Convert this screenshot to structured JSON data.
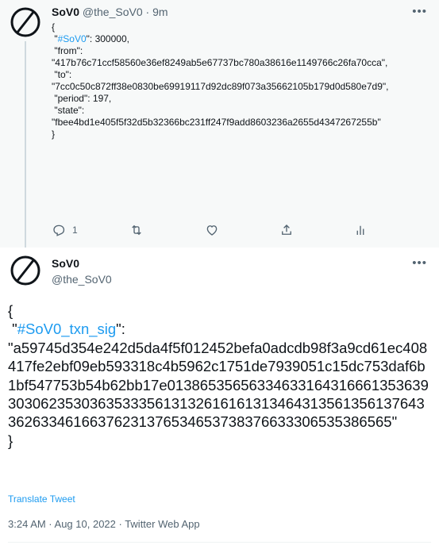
{
  "parent_tweet": {
    "display_name": "SoV0",
    "handle": "@the_SoV0",
    "separator": "·",
    "time": "9m",
    "body": {
      "open": "{",
      "hashtag_quote": " \"",
      "hashtag": "#SoV0",
      "hashtag_rest": "\": 300000,",
      "from_key": " \"from\":",
      "from_value": "\"417b76c71ccf58560e36ef8249ab5e67737bc780a38616e1149766c26fa70cca\",",
      "to_key": " \"to\":",
      "to_value": "\"7cc0c50c872ff38e0830be69919117d92dc89f073a35662105b179d0d580e7d9\",",
      "period": " \"period\": 197,",
      "state_key": " \"state\":",
      "state_value": "\"fbee4bd1e405f5f32d5b32366bc231ff247f9add8603236a2655d4347267255b\"",
      "close": "}"
    },
    "reply_count": "1"
  },
  "main_tweet": {
    "display_name": "SoV0",
    "handle": "@the_SoV0",
    "body": {
      "open": "{",
      "hashtag_quote": " \"",
      "hashtag": "#SoV0_txn_sig",
      "hashtag_rest": "\":",
      "sig_value": "\"a59745d354e242d5da4f5f012452befa0adcdb98f3a9cd61ec408417fe2ebf09eb593318c4b5962c1751de7939051c15dc753daf6b1bf547753b54b62bb17e0138653565633463316431666135363930306235303635333561313261616131346431356135613764336263346166376231376534653738376633306535386565\"",
      "close": "}"
    },
    "translate_label": "Translate Tweet",
    "meta": "3:24 AM · Aug 10, 2022 · Twitter Web App"
  },
  "icons": {
    "avatar": "null-symbol-icon",
    "more": "more-icon",
    "reply": "reply-icon",
    "retweet": "retweet-icon",
    "like": "heart-icon",
    "share": "share-icon",
    "analytics": "analytics-icon"
  }
}
